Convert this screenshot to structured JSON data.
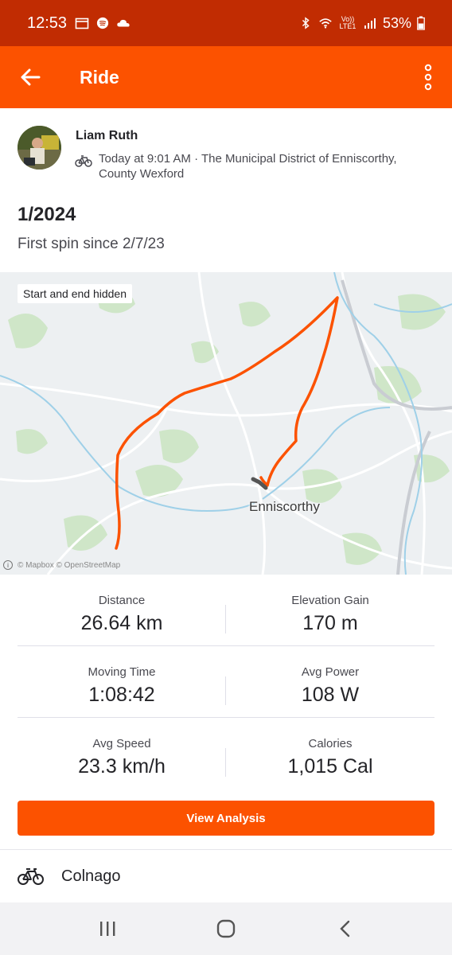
{
  "status_bar": {
    "time": "12:53",
    "network": "Vo)) LTE1",
    "battery": "53%"
  },
  "app_bar": {
    "title": "Ride",
    "background": "#fc5200"
  },
  "athlete": {
    "name": "Liam Ruth"
  },
  "activity": {
    "type_icon": "bike-icon",
    "meta": "Today at 9:01 AM · The Municipal District of Enniscorthy, County Wexford",
    "title": "1/2024",
    "description": "First spin since 2/7/23"
  },
  "map": {
    "privacy_label": "Start and end hidden",
    "town_label": "Enniscorthy",
    "attribution": "© Mapbox © OpenStreetMap",
    "route_color": "#fc5200"
  },
  "stats": [
    [
      {
        "label": "Distance",
        "value": "26.64 km"
      },
      {
        "label": "Elevation Gain",
        "value": "170 m"
      }
    ],
    [
      {
        "label": "Moving Time",
        "value": "1:08:42"
      },
      {
        "label": "Avg Power",
        "value": "108 W"
      }
    ],
    [
      {
        "label": "Avg Speed",
        "value": "23.3 km/h"
      },
      {
        "label": "Calories",
        "value": "1,015 Cal"
      }
    ]
  ],
  "actions": {
    "view_analysis": "View Analysis"
  },
  "gear": {
    "name": "Colnago"
  }
}
